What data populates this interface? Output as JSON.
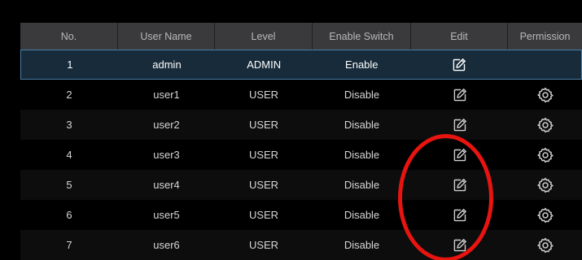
{
  "columns": [
    "No.",
    "User Name",
    "Level",
    "Enable Switch",
    "Edit",
    "Permission"
  ],
  "rows": [
    {
      "no": "1",
      "user": "admin",
      "level": "ADMIN",
      "enable": "Enable",
      "selected": true,
      "permission_icon": false
    },
    {
      "no": "2",
      "user": "user1",
      "level": "USER",
      "enable": "Disable",
      "selected": false,
      "permission_icon": true
    },
    {
      "no": "3",
      "user": "user2",
      "level": "USER",
      "enable": "Disable",
      "selected": false,
      "permission_icon": true
    },
    {
      "no": "4",
      "user": "user3",
      "level": "USER",
      "enable": "Disable",
      "selected": false,
      "permission_icon": true
    },
    {
      "no": "5",
      "user": "user4",
      "level": "USER",
      "enable": "Disable",
      "selected": false,
      "permission_icon": true
    },
    {
      "no": "6",
      "user": "user5",
      "level": "USER",
      "enable": "Disable",
      "selected": false,
      "permission_icon": true
    },
    {
      "no": "7",
      "user": "user6",
      "level": "USER",
      "enable": "Disable",
      "selected": false,
      "permission_icon": true
    }
  ],
  "icons": {
    "edit": "edit-icon",
    "permission": "gear-icon"
  },
  "colors": {
    "background": "#000000",
    "header": "#3a3a3c",
    "selected_row": "#172b3a",
    "selected_border": "#4a7fa8",
    "annotation": "#e8140f"
  }
}
